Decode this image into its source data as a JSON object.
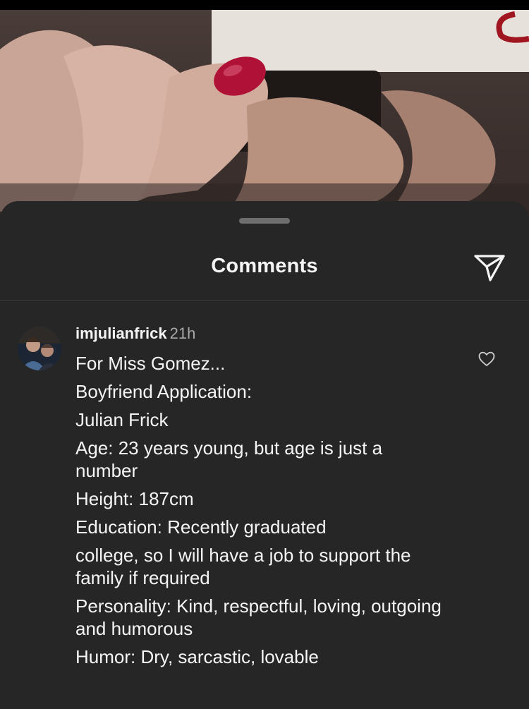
{
  "sheet": {
    "title": "Comments"
  },
  "comment": {
    "username": "imjulianfrick",
    "timestamp": "21h",
    "lines": [
      "For Miss Gomez...",
      "Boyfriend Application:",
      "Julian Frick",
      "Age: 23 years young, but age is just a number",
      "Height: 187cm",
      "Education: Recently graduated",
      "college, so I will have a job to support the family if required",
      "Personality: Kind, respectful, loving, outgoing and humorous",
      "Humor: Dry, sarcastic, lovable"
    ]
  },
  "icons": {
    "share": "paper-plane-icon",
    "like": "heart-outline-icon",
    "grabber": "sheet-grabber"
  },
  "colors": {
    "sheet_background": "#262626",
    "text_primary": "#f5f5f5",
    "text_secondary": "#a8a8a8",
    "divider": "#3a3a3a",
    "nail_polish": "#b01237"
  }
}
